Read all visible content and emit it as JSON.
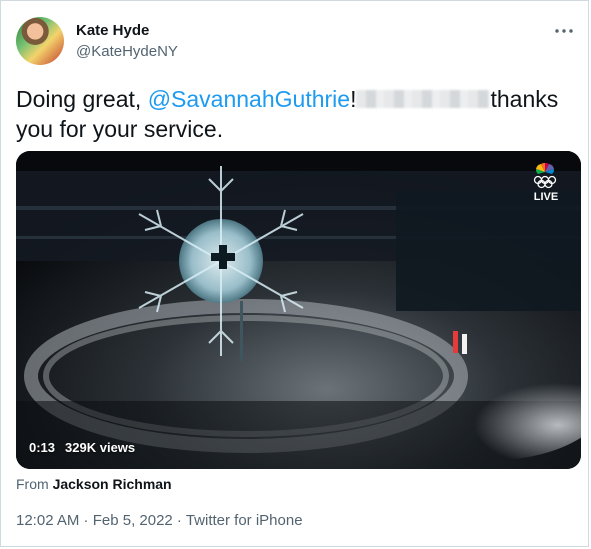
{
  "tweet": {
    "author": {
      "name": "Kate Hyde",
      "handle": "@KateHydeNY"
    },
    "text_before": "Doing great, ",
    "mention": "@SavannahGuthrie",
    "text_mid": "!",
    "text_after_line1": "thanks",
    "text_line2": "you for your service.",
    "media": {
      "time": "0:13",
      "views": "329K views",
      "badge": "LIVE",
      "logo_icon": "nbc-peacock-olympic-rings-icon"
    },
    "attribution": {
      "prefix": "From",
      "source": "Jackson Richman"
    },
    "meta": "12:02 AM · Feb 5, 2022 · Twitter for iPhone"
  },
  "colors": {
    "link": "#1d9bf0",
    "secondary_text": "#536471",
    "primary_text": "#0f1419"
  }
}
